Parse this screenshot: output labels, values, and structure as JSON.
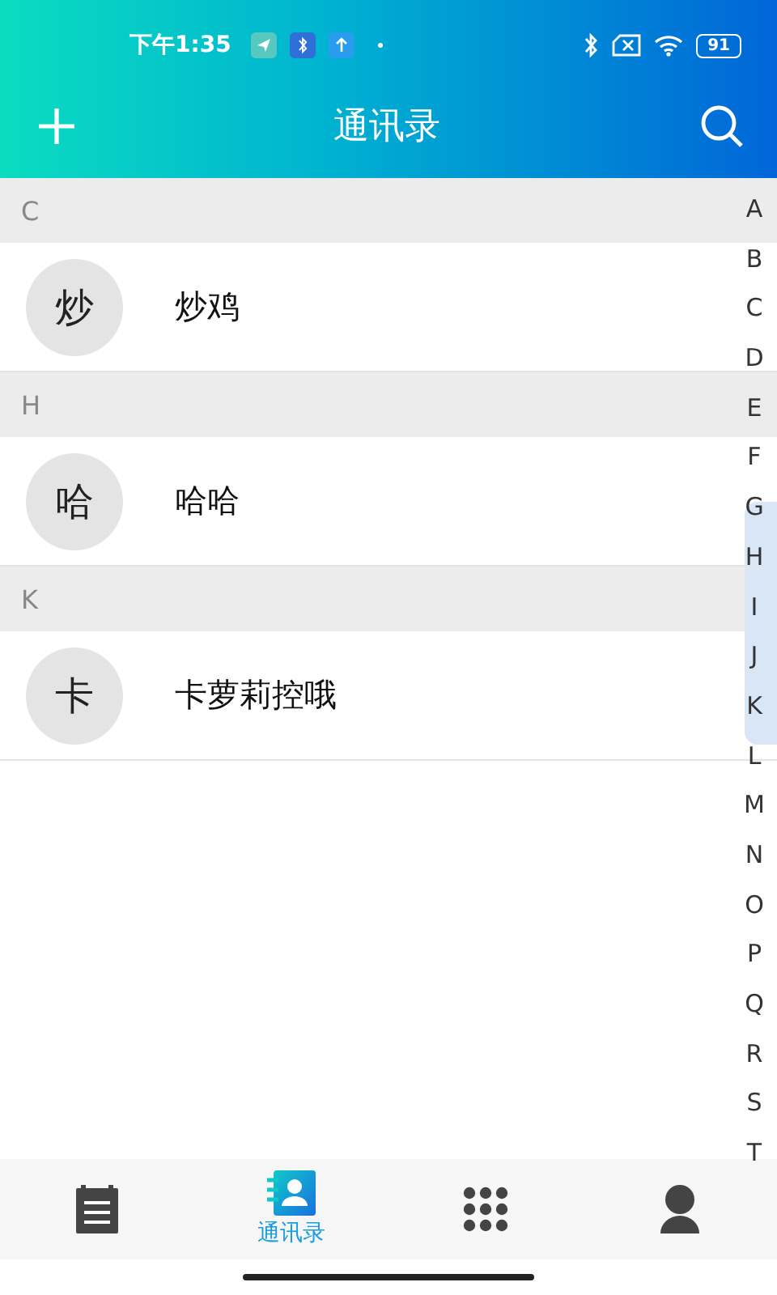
{
  "status_bar": {
    "time": "下午1:35",
    "battery": "91"
  },
  "header": {
    "title": "通讯录"
  },
  "sections": [
    {
      "letter": "C",
      "contacts": [
        {
          "avatar": "炒",
          "name": "炒鸡"
        }
      ]
    },
    {
      "letter": "H",
      "contacts": [
        {
          "avatar": "哈",
          "name": "哈哈"
        }
      ]
    },
    {
      "letter": "K",
      "contacts": [
        {
          "avatar": "卡",
          "name": "卡萝莉控哦"
        }
      ]
    }
  ],
  "index": [
    "A",
    "B",
    "C",
    "D",
    "E",
    "F",
    "G",
    "H",
    "I",
    "J",
    "K",
    "L",
    "M",
    "N",
    "O",
    "P",
    "Q",
    "R",
    "S",
    "T"
  ],
  "tabs": [
    {
      "kind": "notes",
      "selected": false
    },
    {
      "kind": "contacts",
      "label": "通讯录",
      "selected": true
    },
    {
      "kind": "dialpad",
      "selected": false
    },
    {
      "kind": "profile",
      "selected": false
    }
  ]
}
